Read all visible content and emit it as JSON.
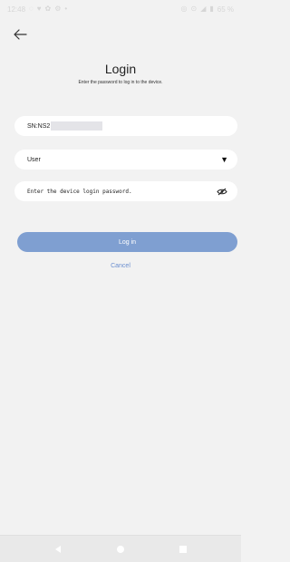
{
  "status_bar": {
    "time": "12:48",
    "battery": "65 %",
    "left_icons": [
      "chat-icon",
      "heart-icon",
      "settings-icon",
      "dot-icon"
    ],
    "right_icons": [
      "vibrate-icon",
      "alarm-icon",
      "signal-icon",
      "battery-icon"
    ]
  },
  "header": {
    "back_icon": "arrow-left-icon"
  },
  "login": {
    "title": "Login",
    "subtitle": "Enter the password to log in to the device.",
    "sn_value": "SN:NS2",
    "role_value": "User",
    "password_placeholder": "Enter the device login password.",
    "password_icon": "eye-slash-icon",
    "login_button": "Log in",
    "cancel_link": "Cancel"
  },
  "nav_bar": {
    "buttons": [
      "back-triangle-icon",
      "home-circle-icon",
      "recents-square-icon"
    ]
  }
}
